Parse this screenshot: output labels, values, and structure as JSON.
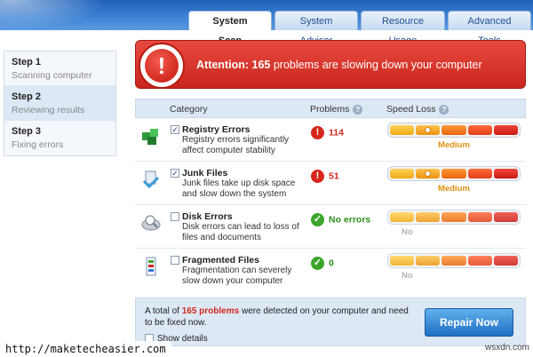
{
  "tabs": [
    {
      "label": "System Scan",
      "active": true
    },
    {
      "label": "System Advisor",
      "active": false
    },
    {
      "label": "Resource Usage",
      "active": false
    },
    {
      "label": "Advanced Tools",
      "active": false
    }
  ],
  "steps": [
    {
      "title": "Step 1",
      "subtitle": "Scanning computer",
      "active": false
    },
    {
      "title": "Step 2",
      "subtitle": "Reviewing results",
      "active": true
    },
    {
      "title": "Step 3",
      "subtitle": "Fixing errors",
      "active": false
    }
  ],
  "alert": {
    "badge": "!",
    "prefix": "Attention:",
    "count": "165",
    "message": "problems are slowing down your computer",
    "color": "#d43328"
  },
  "table": {
    "headers": {
      "category": "Category",
      "problems": "Problems",
      "speed_loss": "Speed Loss",
      "help_glyph": "?"
    },
    "rows": [
      {
        "icon": "registry-cubes-icon",
        "checked": true,
        "title": "Registry Errors",
        "desc": "Registry errors significantly affect computer stability",
        "problems": "114",
        "status": "bad",
        "speed_label": "Medium",
        "speed_level": 0.5
      },
      {
        "icon": "junk-files-icon",
        "checked": true,
        "title": "Junk Files",
        "desc": "Junk files take up disk space and slow down the system",
        "problems": "51",
        "status": "bad",
        "speed_label": "Medium",
        "speed_level": 0.5
      },
      {
        "icon": "disk-icon",
        "checked": false,
        "title": "Disk Errors",
        "desc": "Disk errors can lead to loss of files and documents",
        "problems": "No errors",
        "status": "ok",
        "speed_label": "No",
        "speed_level": 0
      },
      {
        "icon": "fragmented-files-icon",
        "checked": false,
        "title": "Fragmented Files",
        "desc": "Fragmentation can severely slow down your computer",
        "problems": "0",
        "status": "ok",
        "speed_label": "No",
        "speed_level": 0
      }
    ]
  },
  "footer": {
    "text_before": "A total of",
    "count_text": "165 problems",
    "text_after": "were detected on your computer and need to be fixed now.",
    "show_details": "Show details",
    "repair_button": "Repair Now"
  },
  "watermark": {
    "url": "http://maketecheasier.com",
    "site": "wsxdn.com"
  }
}
